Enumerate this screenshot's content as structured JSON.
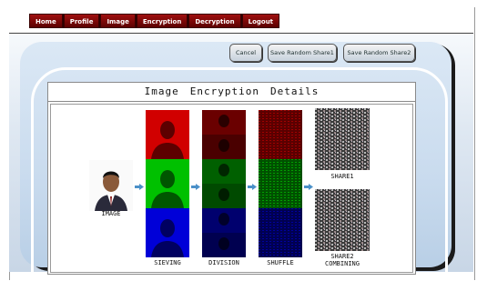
{
  "nav": {
    "items": [
      "Home",
      "Profile",
      "Image",
      "Encryption",
      "Decryption",
      "Logout"
    ]
  },
  "buttons": {
    "cancel": "Cancel",
    "share1": "Save Random Share1",
    "share2": "Save Random Share2"
  },
  "details": {
    "title": [
      "Image",
      "Encryption",
      "Details"
    ]
  },
  "captions": {
    "image": "IMAGE",
    "sieving": "SIEVING",
    "division": "DIVISION",
    "shuffle": "SHUFFLE",
    "share1": "SHARE1",
    "share2_line1": "SHARE2",
    "share2_line2": "COMBINING"
  },
  "colors": {
    "nav_red": "#8b0000",
    "arrow_blue": "#4a90c8",
    "red": "#d10000",
    "green": "#00c000",
    "blue": "#0000d8"
  }
}
